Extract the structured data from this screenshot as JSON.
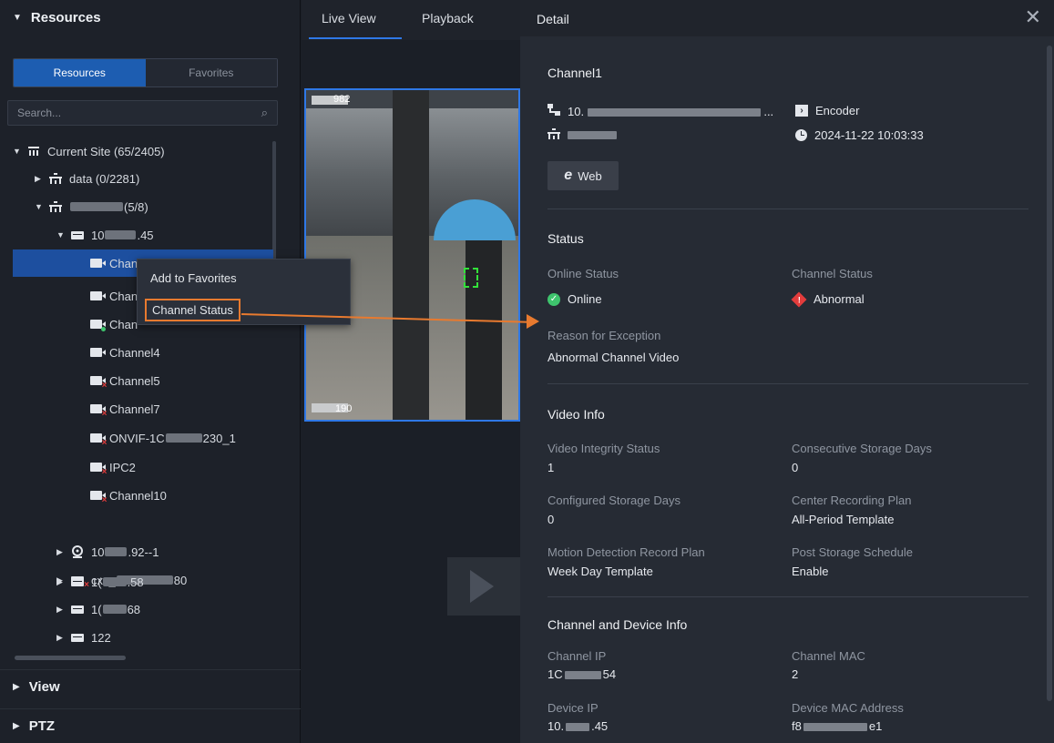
{
  "left": {
    "resources_header": "Resources",
    "segment": {
      "resources": "Resources",
      "favorites": "Favorites"
    },
    "search_placeholder": "Search...",
    "tree": {
      "current_site": "Current Site (65/2405)",
      "data_node": "data (0/2281)",
      "site_node_suffix": "(5/8)",
      "device_prefix": "10",
      "device_suffix": ".45",
      "channel1": "Chan",
      "channel2": "Chan",
      "channel3": "Chan",
      "channel4": "Channel4",
      "channel5": "Channel5",
      "channel7": "Channel7",
      "onvif_prefix": "ONVIF-1C",
      "onvif_suffix": "230_1",
      "ipc2": "IPC2",
      "channel10": "Channel10",
      "node_92_prefix": "10",
      "node_92_suffix": ".92--1",
      "node_cxx_prefix": "cxx_",
      "node_cxx_suffix": "80",
      "node_58_prefix": "1(",
      "node_58_suffix": ".58",
      "node_68_prefix": "1(",
      "node_68_suffix": "68",
      "node_122": "122"
    },
    "view_header": "View",
    "ptz_header": "PTZ"
  },
  "context_menu": {
    "add_favorites": "Add to Favorites",
    "channel_status": "Channel Status"
  },
  "center": {
    "tab_live": "Live View",
    "tab_playback": "Playback",
    "overlay_top": "982",
    "overlay_bottom": "190"
  },
  "detail": {
    "title": "Detail",
    "channel_name": "Channel1",
    "ip_prefix": "10.",
    "ip_suffix": "...",
    "device_type": "Encoder",
    "timestamp": "2024-11-22 10:03:33",
    "web_button": "Web",
    "status_header": "Status",
    "online_status_label": "Online Status",
    "online_status_value": "Online",
    "channel_status_label": "Channel Status",
    "channel_status_value": "Abnormal",
    "reason_label": "Reason for Exception",
    "reason_value": "Abnormal Channel Video",
    "video_info_header": "Video Info",
    "integrity_label": "Video Integrity Status",
    "integrity_value": "1",
    "consecutive_label": "Consecutive Storage Days",
    "consecutive_value": "0",
    "configured_label": "Configured Storage Days",
    "configured_value": "0",
    "center_plan_label": "Center Recording Plan",
    "center_plan_value": "All-Period Template",
    "motion_plan_label": "Motion Detection Record Plan",
    "motion_plan_value": "Week Day Template",
    "post_storage_label": "Post Storage Schedule",
    "post_storage_value": "Enable",
    "cd_info_header": "Channel and Device Info",
    "channel_ip_label": "Channel IP",
    "channel_ip_prefix": "1C",
    "channel_ip_suffix": "54",
    "channel_mac_label": "Channel MAC",
    "channel_mac_value": "2",
    "device_ip_label": "Device IP",
    "device_ip_prefix": "10.",
    "device_ip_suffix": ".45",
    "device_mac_label": "Device MAC Address",
    "device_mac_prefix": "f8",
    "device_mac_suffix": "e1"
  },
  "colors": {
    "accent": "#2f78e6",
    "selected_row": "#1d4f9f",
    "highlight_arrow": "#e87a2f",
    "online": "#3ec46d",
    "abnormal": "#e23c3c"
  }
}
